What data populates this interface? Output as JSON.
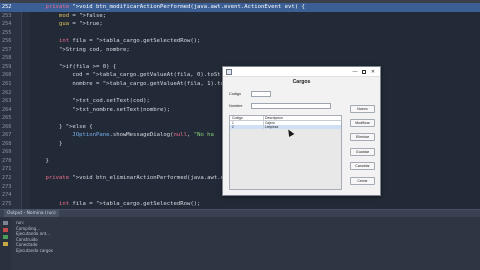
{
  "editor": {
    "lines": [
      {
        "n": "252",
        "text": "    private void btn_modificarActionPerformed(java.awt.event.ActionEvent evt) {"
      },
      {
        "n": "253",
        "text": "        mod = false;"
      },
      {
        "n": "254",
        "text": "        gua = true;"
      },
      {
        "n": "255",
        "text": ""
      },
      {
        "n": "256",
        "text": "        int fila = tabla_cargo.getSelectedRow();"
      },
      {
        "n": "257",
        "text": "        String cod, nombre;"
      },
      {
        "n": "258",
        "text": ""
      },
      {
        "n": "259",
        "text": "        if(fila >= 0) {"
      },
      {
        "n": "260",
        "text": "            cod = tabla_cargo.getValueAt(fila, 0).toSt"
      },
      {
        "n": "261",
        "text": "            nombre = tabla_cargo.getValueAt(fila, 1).to"
      },
      {
        "n": "262",
        "text": ""
      },
      {
        "n": "263",
        "text": "            txt_cod.setText(cod);"
      },
      {
        "n": "264",
        "text": "            txt_nombre.setText(nombre);"
      },
      {
        "n": "265",
        "text": ""
      },
      {
        "n": "266",
        "text": "        } else {"
      },
      {
        "n": "267",
        "text": "            JOptionPane.showMessageDialog(null, \"No ha"
      },
      {
        "n": "268",
        "text": "        }"
      },
      {
        "n": "269",
        "text": ""
      },
      {
        "n": "270",
        "text": "    }"
      },
      {
        "n": "271",
        "text": ""
      },
      {
        "n": "272",
        "text": "    private void btn_eliminarActionPerformed(java.awt.event.A"
      },
      {
        "n": "273",
        "text": ""
      },
      {
        "n": "274",
        "text": ""
      },
      {
        "n": "275",
        "text": "        int fila = tabla_cargo.getSelectedRow();"
      },
      {
        "n": "276",
        "text": ""
      }
    ],
    "selected_line": "252"
  },
  "output": {
    "tab_label": "Output - Nomina (run)",
    "lines": [
      "run:",
      "Compiling...",
      "Ejecutando ant...",
      "Construido",
      "Conectado",
      "Ejecutando cargos"
    ]
  },
  "dialog": {
    "title": "Cargos",
    "window_min": "—",
    "window_close": "✕",
    "codigo_label": "Codigo",
    "codigo_value": "",
    "nombre_label": "Nombre",
    "nombre_value": "",
    "table": {
      "headers": [
        "Codigo",
        "Descripcion"
      ],
      "rows": [
        {
          "codigo": "1",
          "descripcion": "Cajero"
        },
        {
          "codigo": "2",
          "descripcion": "Limpieza"
        }
      ],
      "selected_row": 1
    },
    "buttons": [
      "Nuevo",
      "Modificar",
      "Eliminar",
      "Guardar",
      "Cancelar",
      "Cerrar"
    ]
  },
  "colors": {
    "editor_bg": "#232a37",
    "selection": "#3b5f94",
    "keyword": "#f06c8c"
  }
}
